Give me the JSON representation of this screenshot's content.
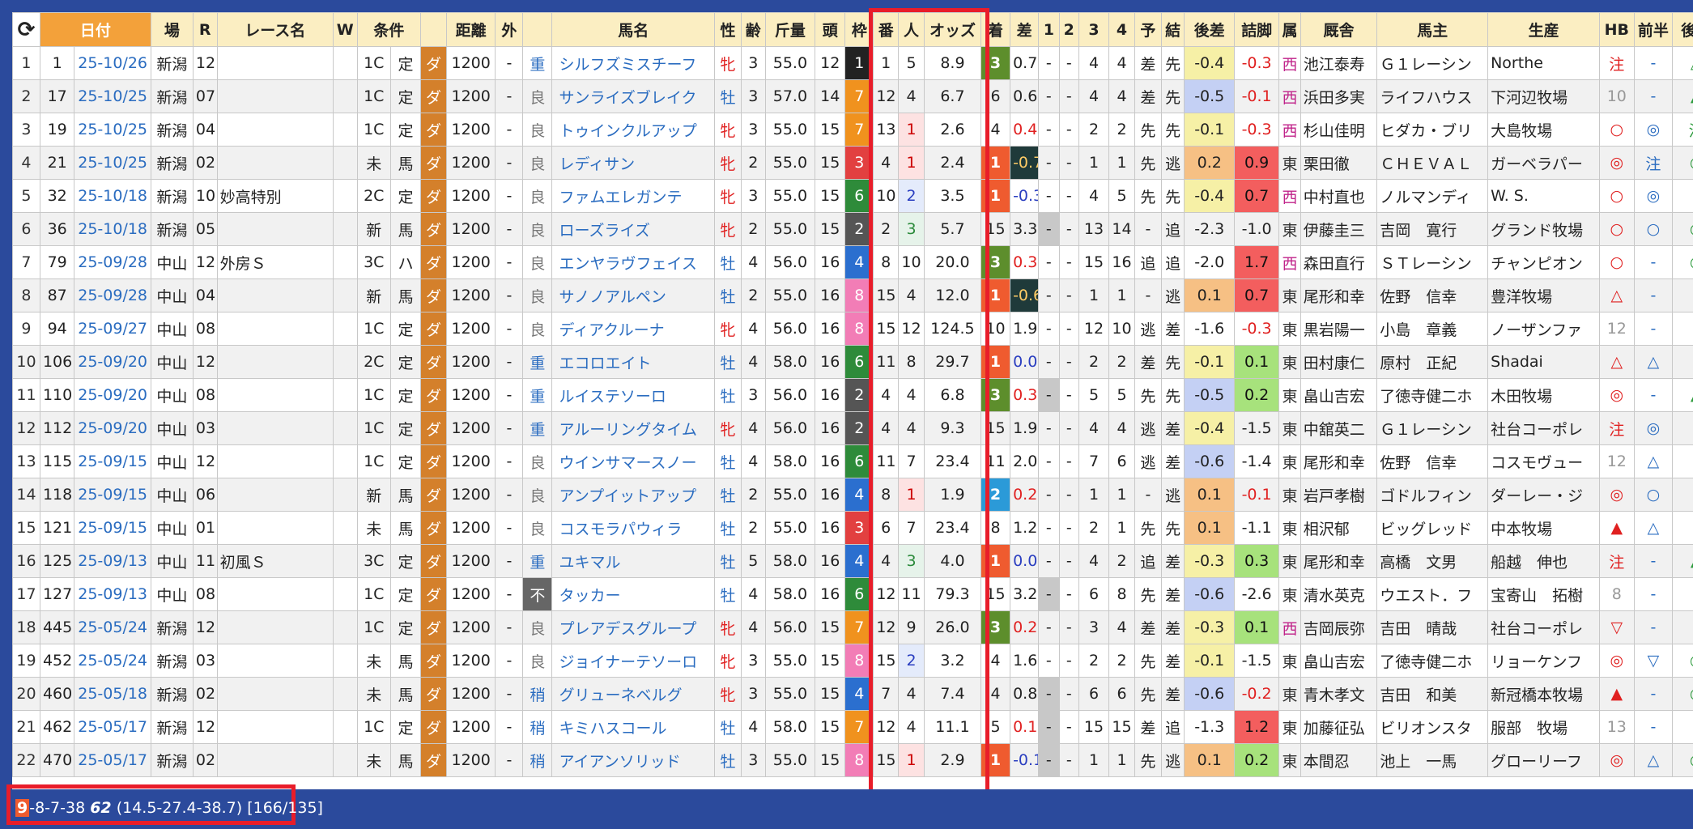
{
  "headers": [
    "",
    "日付",
    "場",
    "R",
    "レース名",
    "W",
    "条件",
    "",
    "",
    "距離",
    "外",
    "",
    "馬名",
    "性",
    "齢",
    "斤量",
    "頭",
    "枠",
    "番",
    "人",
    "オッズ",
    "着",
    "差",
    "1",
    "2",
    "3",
    "4",
    "予",
    "結",
    "後差",
    "詰脚",
    "属",
    "厩舎",
    "馬主",
    "生産",
    "HB",
    "前半",
    "後半"
  ],
  "refresh_icon": "refresh-icon",
  "rows": [
    [
      "1",
      "1",
      "25-10/26",
      "新潟",
      "12",
      "",
      "",
      "1C",
      "定",
      "ダ",
      "1200",
      "-",
      "重",
      "シルフズミスチーフ",
      "牝",
      "3",
      "55.0",
      "12",
      "1",
      "1",
      "5",
      "8.9",
      "3",
      "0.7",
      "-",
      "-",
      "4",
      "4",
      "差",
      "先",
      "-0.4",
      "-0.3",
      "西",
      "池江泰寿",
      "Ｇ１レーシン",
      "Northe",
      "注",
      "-",
      "△"
    ],
    [
      "2",
      "17",
      "25-10/25",
      "新潟",
      "07",
      "",
      "",
      "1C",
      "定",
      "ダ",
      "1200",
      "-",
      "良",
      "サンライズブレイク",
      "牡",
      "3",
      "57.0",
      "14",
      "7",
      "12",
      "4",
      "6.7",
      "6",
      "0.6",
      "-",
      "-",
      "4",
      "4",
      "差",
      "先",
      "-0.5",
      "-0.1",
      "西",
      "浜田多実",
      "ライフハウス",
      "下河辺牧場",
      "10",
      "-",
      "▲"
    ],
    [
      "3",
      "19",
      "25-10/25",
      "新潟",
      "04",
      "",
      "",
      "1C",
      "定",
      "ダ",
      "1200",
      "-",
      "良",
      "トゥインクルアップ",
      "牝",
      "3",
      "55.0",
      "15",
      "7",
      "13",
      "1",
      "2.6",
      "4",
      "0.4",
      "-",
      "-",
      "2",
      "2",
      "先",
      "先",
      "-0.1",
      "-0.3",
      "西",
      "杉山佳明",
      "ヒダカ・ブリ",
      "大島牧場",
      "○",
      "◎",
      "注"
    ],
    [
      "4",
      "21",
      "25-10/25",
      "新潟",
      "02",
      "",
      "",
      "未",
      "馬",
      "ダ",
      "1200",
      "-",
      "良",
      "レディサン",
      "牝",
      "2",
      "55.0",
      "15",
      "3",
      "4",
      "1",
      "2.4",
      "1",
      "-0.7",
      "-",
      "-",
      "1",
      "1",
      "先",
      "逃",
      "0.2",
      "0.9",
      "東",
      "栗田徹",
      "ＣＨＥＶＡＬ",
      "ガーベラパー",
      "◎",
      "注",
      "◎"
    ],
    [
      "5",
      "32",
      "25-10/18",
      "新潟",
      "10",
      "妙高特別",
      "",
      "2C",
      "定",
      "ダ",
      "1200",
      "-",
      "良",
      "ファムエレガンテ",
      "牝",
      "3",
      "55.0",
      "15",
      "6",
      "10",
      "2",
      "3.5",
      "1",
      "-0.3",
      "-",
      "-",
      "4",
      "5",
      "先",
      "先",
      "-0.4",
      "0.7",
      "西",
      "中村直也",
      "ノルマンディ",
      "W. S.",
      "○",
      "◎",
      "-"
    ],
    [
      "6",
      "36",
      "25-10/18",
      "新潟",
      "05",
      "",
      "",
      "新",
      "馬",
      "ダ",
      "1200",
      "-",
      "良",
      "ローズライズ",
      "牝",
      "2",
      "55.0",
      "15",
      "2",
      "2",
      "3",
      "5.7",
      "15",
      "3.3",
      "-",
      "-",
      "13",
      "14",
      "-",
      "追",
      "-2.3",
      "-1.0",
      "東",
      "伊藤圭三",
      "吉岡　寛行",
      "グランド牧場",
      "○",
      "○",
      "○"
    ],
    [
      "7",
      "79",
      "25-09/28",
      "中山",
      "12",
      "外房Ｓ",
      "",
      "3C",
      "ハ",
      "ダ",
      "1200",
      "-",
      "良",
      "エンヤラヴフェイス",
      "牡",
      "4",
      "56.0",
      "16",
      "4",
      "8",
      "10",
      "20.0",
      "3",
      "0.3",
      "-",
      "-",
      "15",
      "16",
      "追",
      "追",
      "-2.0",
      "1.7",
      "西",
      "森田直行",
      "ＳＴレーシン",
      "チャンピオン",
      "○",
      "-",
      "◎"
    ],
    [
      "8",
      "87",
      "25-09/28",
      "中山",
      "04",
      "",
      "",
      "新",
      "馬",
      "ダ",
      "1200",
      "-",
      "良",
      "サノノアルペン",
      "牡",
      "2",
      "55.0",
      "16",
      "8",
      "15",
      "4",
      "12.0",
      "1",
      "-0.6",
      "-",
      "-",
      "1",
      "1",
      "-",
      "逃",
      "0.1",
      "0.7",
      "東",
      "尾形和幸",
      "佐野　信幸",
      "豊洋牧場",
      "△",
      "-",
      "-"
    ],
    [
      "9",
      "94",
      "25-09/27",
      "中山",
      "08",
      "",
      "",
      "1C",
      "定",
      "ダ",
      "1200",
      "-",
      "良",
      "ディアクルーナ",
      "牝",
      "4",
      "56.0",
      "16",
      "8",
      "15",
      "12",
      "124.5",
      "10",
      "1.9",
      "-",
      "-",
      "12",
      "10",
      "逃",
      "差",
      "-1.6",
      "-0.3",
      "東",
      "黒岩陽一",
      "小島　章義",
      "ノーザンファ",
      "12",
      "-",
      "-"
    ],
    [
      "10",
      "106",
      "25-09/20",
      "中山",
      "12",
      "",
      "",
      "2C",
      "定",
      "ダ",
      "1200",
      "-",
      "重",
      "エコロエイト",
      "牡",
      "4",
      "58.0",
      "16",
      "6",
      "11",
      "8",
      "29.7",
      "1",
      "0.0",
      "-",
      "-",
      "2",
      "2",
      "差",
      "先",
      "-0.1",
      "0.1",
      "東",
      "田村康仁",
      "原村　正紀",
      "Shadai",
      "△",
      "△",
      "-"
    ],
    [
      "11",
      "110",
      "25-09/20",
      "中山",
      "08",
      "",
      "",
      "1C",
      "定",
      "ダ",
      "1200",
      "-",
      "重",
      "ルイステソーロ",
      "牡",
      "3",
      "56.0",
      "16",
      "2",
      "4",
      "4",
      "6.8",
      "3",
      "0.3",
      "-",
      "-",
      "5",
      "5",
      "先",
      "先",
      "-0.5",
      "0.2",
      "東",
      "畠山吉宏",
      "了徳寺健二ホ",
      "木田牧場",
      "◎",
      "-",
      "▲"
    ],
    [
      "12",
      "112",
      "25-09/20",
      "中山",
      "03",
      "",
      "",
      "1C",
      "定",
      "ダ",
      "1200",
      "-",
      "重",
      "アルーリングタイム",
      "牝",
      "4",
      "56.0",
      "16",
      "2",
      "4",
      "4",
      "9.3",
      "15",
      "1.9",
      "-",
      "-",
      "4",
      "4",
      "逃",
      "差",
      "-0.4",
      "-1.5",
      "東",
      "中舘英二",
      "Ｇ１レーシン",
      "社台コーポレ",
      "注",
      "◎",
      "-"
    ],
    [
      "13",
      "115",
      "25-09/15",
      "中山",
      "12",
      "",
      "",
      "1C",
      "定",
      "ダ",
      "1200",
      "-",
      "良",
      "ウインサマースノー",
      "牡",
      "4",
      "58.0",
      "16",
      "6",
      "11",
      "7",
      "23.4",
      "11",
      "2.0",
      "-",
      "-",
      "7",
      "6",
      "逃",
      "差",
      "-0.6",
      "-1.4",
      "東",
      "尾形和幸",
      "佐野　信幸",
      "コスモヴュー",
      "12",
      "△",
      "-"
    ],
    [
      "14",
      "118",
      "25-09/15",
      "中山",
      "06",
      "",
      "",
      "新",
      "馬",
      "ダ",
      "1200",
      "-",
      "良",
      "アンプイットアップ",
      "牡",
      "2",
      "55.0",
      "16",
      "4",
      "8",
      "1",
      "1.9",
      "2",
      "0.2",
      "-",
      "-",
      "1",
      "1",
      "-",
      "逃",
      "0.1",
      "-0.1",
      "東",
      "岩戸孝樹",
      "ゴドルフィン",
      "ダーレー・ジ",
      "◎",
      "○",
      "-"
    ],
    [
      "15",
      "121",
      "25-09/15",
      "中山",
      "01",
      "",
      "",
      "未",
      "馬",
      "ダ",
      "1200",
      "-",
      "良",
      "コスモラパウィラ",
      "牡",
      "2",
      "55.0",
      "16",
      "3",
      "6",
      "7",
      "23.4",
      "8",
      "1.2",
      "-",
      "-",
      "2",
      "1",
      "先",
      "先",
      "0.1",
      "-1.1",
      "東",
      "相沢郁",
      "ビッグレッド",
      "中本牧場",
      "▲",
      "△",
      "-"
    ],
    [
      "16",
      "125",
      "25-09/13",
      "中山",
      "11",
      "初風Ｓ",
      "",
      "3C",
      "定",
      "ダ",
      "1200",
      "-",
      "重",
      "ユキマル",
      "牡",
      "5",
      "58.0",
      "16",
      "4",
      "4",
      "3",
      "4.0",
      "1",
      "0.0",
      "-",
      "-",
      "4",
      "2",
      "追",
      "差",
      "-0.3",
      "0.3",
      "東",
      "尾形和幸",
      "高橋　文男",
      "船越　伸也",
      "注",
      "-",
      "▲"
    ],
    [
      "17",
      "127",
      "25-09/13",
      "中山",
      "08",
      "",
      "",
      "1C",
      "定",
      "ダ",
      "1200",
      "-",
      "不",
      "タッカー",
      "牡",
      "4",
      "58.0",
      "16",
      "6",
      "12",
      "11",
      "79.3",
      "15",
      "3.2",
      "-",
      "-",
      "6",
      "8",
      "先",
      "差",
      "-0.6",
      "-2.6",
      "東",
      "清水英克",
      "ウエスト．フ",
      "宝寄山　拓樹",
      "8",
      "-",
      "-"
    ],
    [
      "18",
      "445",
      "25-05/24",
      "新潟",
      "12",
      "",
      "",
      "1C",
      "定",
      "ダ",
      "1200",
      "-",
      "良",
      "プレアデスグループ",
      "牝",
      "4",
      "56.0",
      "15",
      "7",
      "12",
      "9",
      "26.0",
      "3",
      "0.2",
      "-",
      "-",
      "3",
      "4",
      "差",
      "差",
      "-0.3",
      "0.1",
      "西",
      "吉岡辰弥",
      "吉田　晴哉",
      "社台コーポレ",
      "▽",
      "-",
      "-"
    ],
    [
      "19",
      "452",
      "25-05/24",
      "新潟",
      "03",
      "",
      "",
      "未",
      "馬",
      "ダ",
      "1200",
      "-",
      "良",
      "ジョイナーテソーロ",
      "牝",
      "3",
      "55.0",
      "15",
      "8",
      "15",
      "2",
      "3.2",
      "4",
      "1.6",
      "-",
      "-",
      "2",
      "2",
      "先",
      "差",
      "-0.1",
      "-1.5",
      "東",
      "畠山吉宏",
      "了徳寺健二ホ",
      "リョーケンフ",
      "◎",
      "▽",
      "○"
    ],
    [
      "20",
      "460",
      "25-05/18",
      "新潟",
      "02",
      "",
      "",
      "未",
      "馬",
      "ダ",
      "1200",
      "-",
      "稍",
      "グリューネベルグ",
      "牝",
      "3",
      "55.0",
      "15",
      "4",
      "7",
      "4",
      "7.4",
      "4",
      "0.8",
      "-",
      "-",
      "6",
      "6",
      "先",
      "差",
      "-0.6",
      "-0.2",
      "東",
      "青木孝文",
      "吉田　和美",
      "新冠橋本牧場",
      "▲",
      "-",
      "◎"
    ],
    [
      "21",
      "462",
      "25-05/17",
      "新潟",
      "12",
      "",
      "",
      "1C",
      "定",
      "ダ",
      "1200",
      "-",
      "稍",
      "キミハスコール",
      "牡",
      "4",
      "58.0",
      "15",
      "7",
      "12",
      "4",
      "11.1",
      "5",
      "0.1",
      "-",
      "-",
      "15",
      "15",
      "差",
      "追",
      "-1.3",
      "1.2",
      "東",
      "加藤征弘",
      "ビリオンスタ",
      "服部　牧場",
      "13",
      "-",
      "-"
    ],
    [
      "22",
      "470",
      "25-05/17",
      "新潟",
      "02",
      "",
      "",
      "未",
      "馬",
      "ダ",
      "1200",
      "-",
      "稍",
      "アイアンソリッド",
      "牡",
      "3",
      "55.0",
      "15",
      "8",
      "15",
      "1",
      "2.9",
      "1",
      "-0.1",
      "-",
      "-",
      "1",
      "1",
      "先",
      "逃",
      "0.1",
      "0.2",
      "東",
      "本間忍",
      "池上　一馬",
      "グローリーフ",
      "◎",
      "△",
      "○"
    ]
  ],
  "summary": {
    "wins": "9",
    "rest": "-8-7-38",
    "total": "62",
    "rates": "(14.5-27.4-38.7)",
    "ratio": "[166/135]"
  },
  "colors": {
    "background": "#2b4a9c",
    "date_header": "#f3a13a",
    "highlight_box": "#e81d2a",
    "finish_1": "#ef5b2f",
    "finish_2": "#2b9ad8",
    "finish_3": "#5d8e2c"
  }
}
